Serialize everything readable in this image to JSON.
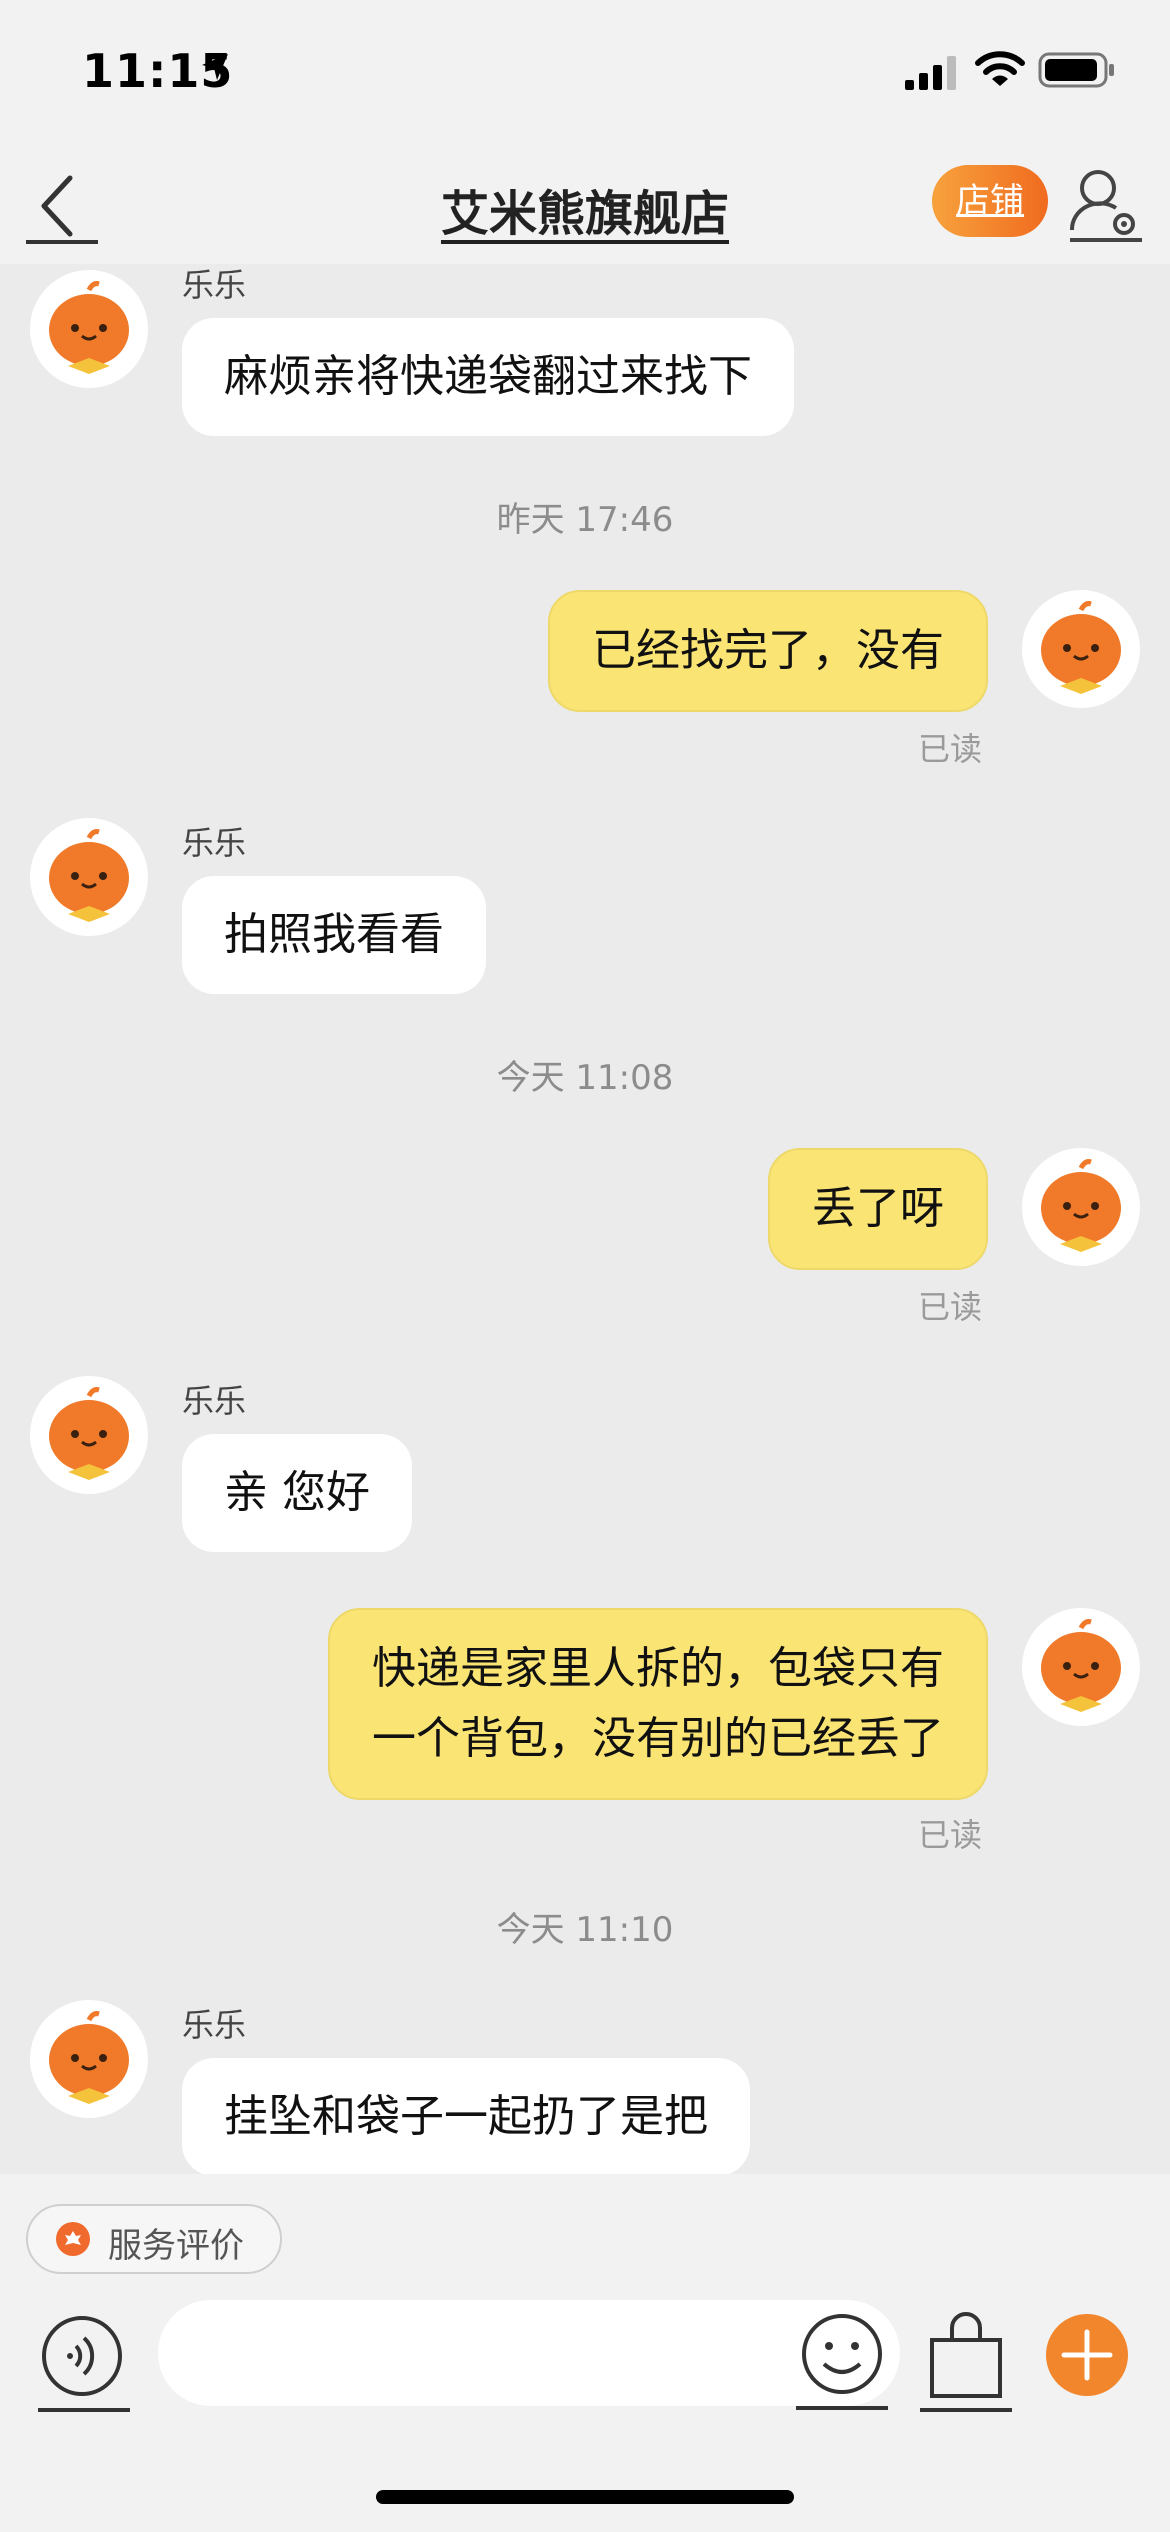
{
  "status_bar": {
    "time": "11:15"
  },
  "nav": {
    "title": "艾米熊旗舰店",
    "store_button": "店铺"
  },
  "messages": [
    {
      "dir": "in",
      "sender": "乐乐",
      "text": "麻烦亲将快递袋翻过来找下"
    },
    {
      "dir": "out",
      "text": "已经找完了，没有",
      "read": "已读"
    },
    {
      "dir": "in",
      "sender": "乐乐",
      "text": "拍照我看看"
    },
    {
      "dir": "out",
      "text": "丢了呀",
      "read": "已读"
    },
    {
      "dir": "in",
      "sender": "乐乐",
      "text": "亲 您好"
    },
    {
      "dir": "out",
      "text": "快递是家里人拆的，包袋只有\n一个背包，没有别的已经丢了",
      "read": "已读"
    },
    {
      "dir": "in",
      "sender": "乐乐",
      "text": "挂坠和袋子一起扔了是把"
    }
  ],
  "timestamps": [
    "昨天 17:46",
    "今天 11:08",
    "今天 11:10"
  ],
  "bottom": {
    "rate_label": "服务评价",
    "input_placeholder": ""
  },
  "colors": {
    "accent": "#f2862d",
    "out_bubble": "#fae474",
    "in_bubble": "#ffffff",
    "background": "#ebebeb"
  },
  "icons": [
    "back-arrow-icon",
    "location-arrow-icon",
    "signal-icon",
    "wifi-icon",
    "battery-icon",
    "profile-settings-icon",
    "voice-icon",
    "emoji-icon",
    "shopping-bag-icon",
    "plus-icon",
    "rating-icon"
  ]
}
